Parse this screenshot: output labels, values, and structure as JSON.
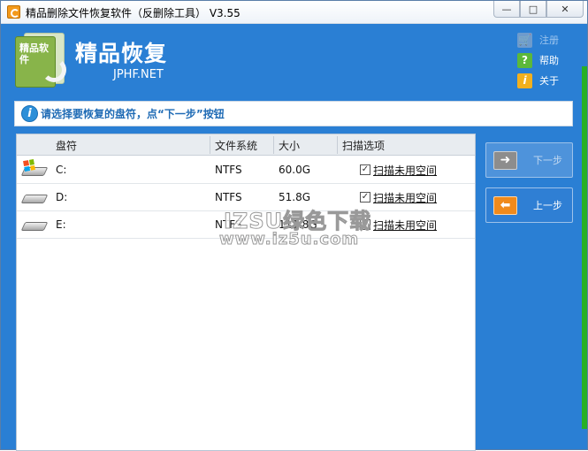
{
  "window": {
    "title": "精品删除文件恢复软件（反删除工具） V3.55",
    "buttons": {
      "minimize": "—",
      "maximize": "□",
      "close": "✕"
    }
  },
  "header": {
    "logo_text": "精品软件",
    "brand_title": "精品恢复",
    "brand_url": "JPHF.NET",
    "menu": [
      {
        "icon": "cart-icon",
        "label": "注册",
        "enabled": false
      },
      {
        "icon": "question-icon",
        "label": "帮助",
        "enabled": true
      },
      {
        "icon": "info-icon",
        "label": "关于",
        "enabled": true
      }
    ]
  },
  "instruction": "请选择要恢复的盘符，点“下一步”按钮",
  "table": {
    "columns": [
      "盘符",
      "文件系统",
      "大小",
      "扫描选项"
    ],
    "rows": [
      {
        "drive": "C:",
        "fs": "NTFS",
        "size": "60.0G",
        "option": "扫描未用空间",
        "checked": true,
        "system": true
      },
      {
        "drive": "D:",
        "fs": "NTFS",
        "size": "51.8G",
        "option": "扫描未用空间",
        "checked": true,
        "system": false
      },
      {
        "drive": "E:",
        "fs": "NTFS",
        "size": "111.8G",
        "option": "扫描未用空间",
        "checked": true,
        "system": false
      }
    ]
  },
  "nav": {
    "next_label": "下一步",
    "next_enabled": false,
    "prev_label": "上一步",
    "prev_enabled": true
  },
  "watermark": {
    "line1": "IZSU绿色下载",
    "line2": "www.iz5u.com"
  },
  "colors": {
    "window_bg": "#2a7fd4",
    "accent_green": "#26b026",
    "instruction_text": "#1f6bb5",
    "prev_icon": "#f08a1c",
    "next_icon": "#8d8d8d"
  }
}
